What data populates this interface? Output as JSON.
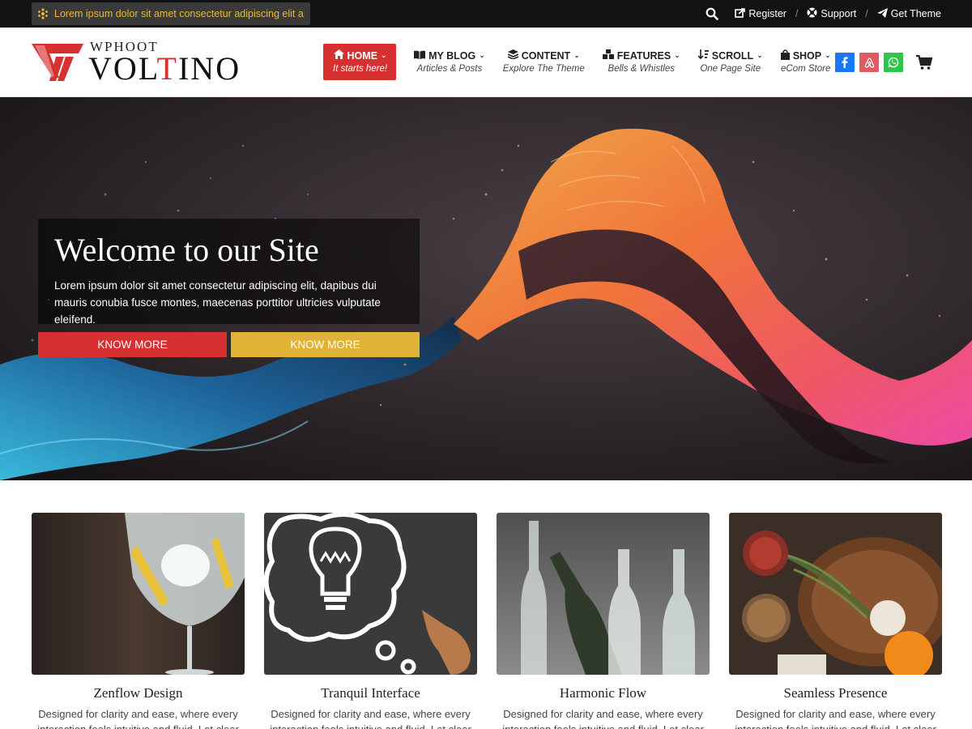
{
  "topbar": {
    "announcement": "Lorem ipsum dolor sit amet consectetur adipiscing elit a",
    "links": [
      {
        "label": "Register",
        "icon": "register-icon"
      },
      {
        "label": "Support",
        "icon": "support-icon"
      },
      {
        "label": "Get Theme",
        "icon": "paper-plane-icon"
      }
    ],
    "separator": "/"
  },
  "header": {
    "logo_small": "WPHOOT",
    "logo_big_1": "VOL",
    "logo_big_2": "T",
    "logo_big_3": "INO"
  },
  "nav": {
    "items": [
      {
        "label": "HOME",
        "sub": "It starts here!",
        "icon": "home-icon"
      },
      {
        "label": "MY BLOG",
        "sub": "Articles & Posts",
        "icon": "book-icon"
      },
      {
        "label": "CONTENT",
        "sub": "Explore The Theme",
        "icon": "layers-icon"
      },
      {
        "label": "FEATURES",
        "sub": "Bells & Whistles",
        "icon": "cubes-icon"
      },
      {
        "label": "SCROLL",
        "sub": "One Page Site",
        "icon": "sort-icon"
      },
      {
        "label": "SHOP",
        "sub": "eCom Store",
        "icon": "bag-icon"
      }
    ]
  },
  "social": [
    {
      "name": "facebook",
      "color": "#1877f2"
    },
    {
      "name": "airbnb",
      "color": "#e05a64"
    },
    {
      "name": "whatsapp",
      "color": "#2ec64a"
    }
  ],
  "hero": {
    "title": "Welcome to our Site",
    "text": "Lorem ipsum dolor sit amet consectetur adipiscing elit, dapibus dui mauris conubia fusce montes, maecenas porttitor ultricies vulputate eleifend.",
    "button1": "KNOW MORE",
    "button2": "KNOW MORE"
  },
  "cards": [
    {
      "title": "Zenflow Design",
      "desc": "Designed for clarity and ease, where every interaction feels intuitive and fluid. Let clear"
    },
    {
      "title": "Tranquil Interface",
      "desc": "Designed for clarity and ease, where every interaction feels intuitive and fluid. Let clear"
    },
    {
      "title": "Harmonic Flow",
      "desc": "Designed for clarity and ease, where every interaction feels intuitive and fluid. Let clear"
    },
    {
      "title": "Seamless Presence",
      "desc": "Designed for clarity and ease, where every interaction feels intuitive and fluid. Let clear"
    }
  ],
  "colors": {
    "accent": "#d63031",
    "gold": "#e0b236",
    "topbar": "#121212"
  }
}
